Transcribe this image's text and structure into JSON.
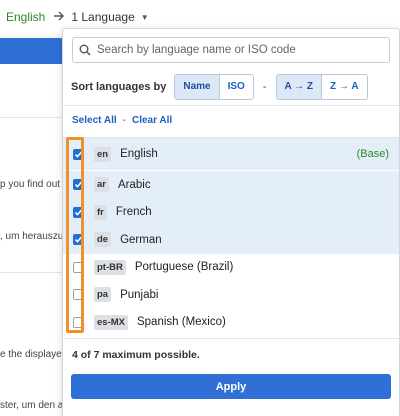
{
  "breadcrumb": {
    "source_language": "English",
    "target_summary": "1 Language"
  },
  "background_fragments": [
    "p you find out",
    ", um herauszu",
    "e the displayed",
    "ster, um den a"
  ],
  "search": {
    "placeholder": "Search by language name or ISO code"
  },
  "sort": {
    "label": "Sort languages by",
    "by_name": "Name",
    "by_iso": "ISO",
    "separator": "-",
    "asc": "A → Z",
    "desc": "Z → A",
    "active_key": "Name",
    "active_order": "A → Z"
  },
  "selection": {
    "select_all": "Select All",
    "separator": "-",
    "clear_all": "Clear All"
  },
  "languages": [
    {
      "code": "en",
      "name": "English",
      "checked": true,
      "tag": "(Base)"
    },
    {
      "code": "ar",
      "name": "Arabic",
      "checked": true
    },
    {
      "code": "fr",
      "name": "French",
      "checked": true
    },
    {
      "code": "de",
      "name": "German",
      "checked": true
    },
    {
      "code": "pt-BR",
      "name": "Portuguese (Brazil)",
      "checked": false
    },
    {
      "code": "pa",
      "name": "Punjabi",
      "checked": false
    },
    {
      "code": "es-MX",
      "name": "Spanish (Mexico)",
      "checked": false
    }
  ],
  "count_text": "4 of 7 maximum possible.",
  "apply_label": "Apply",
  "colors": {
    "accent": "#2f6fd6",
    "checked_row": "#e4eef9",
    "base_tag": "#2a8a2a",
    "highlight": "#f0902a"
  }
}
